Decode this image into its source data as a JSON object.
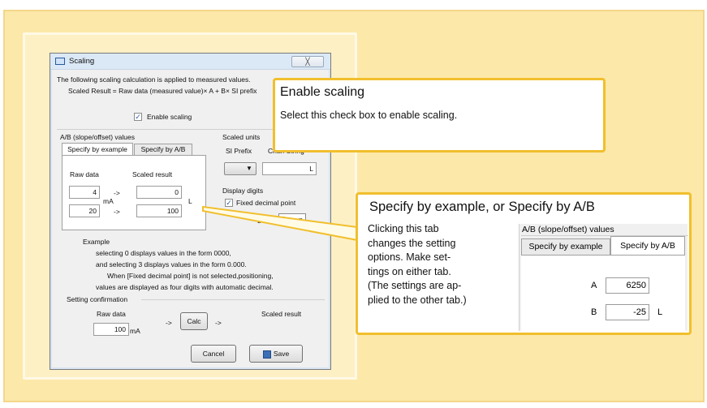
{
  "dialog": {
    "title": "Scaling",
    "close_symbol": "╳",
    "description": "The following scaling calculation is applied to measured values.",
    "formula": "Scaled Result = Raw data (measured value)× A + B× SI prefix",
    "enable_scaling_label": "Enable scaling",
    "ab_group_label": "A/B (slope/offset) values",
    "tabs": [
      "Specify by example",
      "Specify by A/B"
    ],
    "raw_data_header": "Raw data",
    "scaled_result_header": "Scaled result",
    "rows": [
      {
        "raw": "4",
        "arrow": "->",
        "scaled": "0"
      },
      {
        "raw": "20",
        "arrow": "->",
        "scaled": "100"
      }
    ],
    "raw_unit": "mA",
    "scaled_unit": "L",
    "scaled_units_group": "Scaled units",
    "si_prefix_label": "SI Prefix",
    "char_string_label": "Char. String",
    "char_string_value": "L",
    "display_digits_group": "Display digits",
    "fixed_decimal_label": "Fixed decimal point",
    "decimal_label": "Decim",
    "decimal_value": "0",
    "example_title": "Example",
    "example_lines": [
      "selecting 0 displays values in the form 0000,",
      "and selecting 3 displays values in the form 0.000.",
      "When [Fixed decimal point] is not selected,positioning,",
      "values are displayed as four digits with automatic decimal."
    ],
    "setting_confirmation_group": "Setting confirmation",
    "confirm_raw_header": "Raw data",
    "confirm_scaled_header": "Scaled result",
    "confirm_raw_value": "100",
    "confirm_raw_unit": "mA",
    "arrow": "->",
    "calc_button": "Calc",
    "cancel_button": "Cancel",
    "save_button": "Save"
  },
  "callout_enable": {
    "title": "Enable scaling",
    "body": "Select this check box to enable scaling."
  },
  "callout_specify": {
    "title": "Specify by example, or Specify by A/B",
    "body": [
      "Clicking this tab",
      "changes the setting",
      "options. Make set-",
      "tings on either tab.",
      "(The settings are ap-",
      "plied to the other tab.)"
    ],
    "inset_group_label": "A/B (slope/offset) values",
    "inset_tabs": [
      "Specify by example",
      "Specify by A/B"
    ],
    "a_label": "A",
    "a_value": "6250",
    "b_label": "B",
    "b_value": "-25",
    "unit": "L"
  },
  "colors": {
    "frame": "#fce8a8",
    "callout_border": "#f1bf2d"
  }
}
